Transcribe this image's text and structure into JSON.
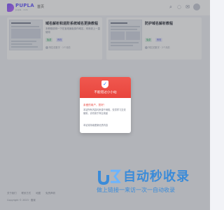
{
  "header": {
    "logo_text": "PUPLA",
    "logo_sub": "pupla · com",
    "nav_home": "首页",
    "icons": [
      "search-icon",
      "bell-icon",
      "mail-icon"
    ]
  },
  "cards": [
    {
      "title": "域名解析和进阶系统域名更换教程",
      "desc": "本教程说明一下在宝塔面板操作域名，来系统上一直使用",
      "tag": "免费",
      "tag2": "教程",
      "meta": "阿拉伯数字 · 1个月前"
    },
    {
      "title": "防护域名解析教程",
      "desc": "",
      "tag": "免费",
      "tag2": "教程",
      "meta": "阿拉伯数字 · 2个月前"
    }
  ],
  "modal": {
    "title": "不能错过小小站",
    "greeting": "亲爱的用户，您好！",
    "body": "本站所有内容均来源于网络，仅供学习交流使用，请勿用于商业用途",
    "footer": "本站将持续更新优质内容"
  },
  "footer": {
    "links": [
      "关于我们",
      "联系方式",
      "地图",
      "免责声明"
    ],
    "copyright": "Copyright © 2023 · 备案"
  },
  "watermark": {
    "text": "自动秒收录",
    "sub": "做上链接一来访一次一自动收录"
  },
  "colors": {
    "accent": "#6a5cff",
    "modal_red": "#e8453d",
    "watermark_blue": "#3a8bd9"
  }
}
